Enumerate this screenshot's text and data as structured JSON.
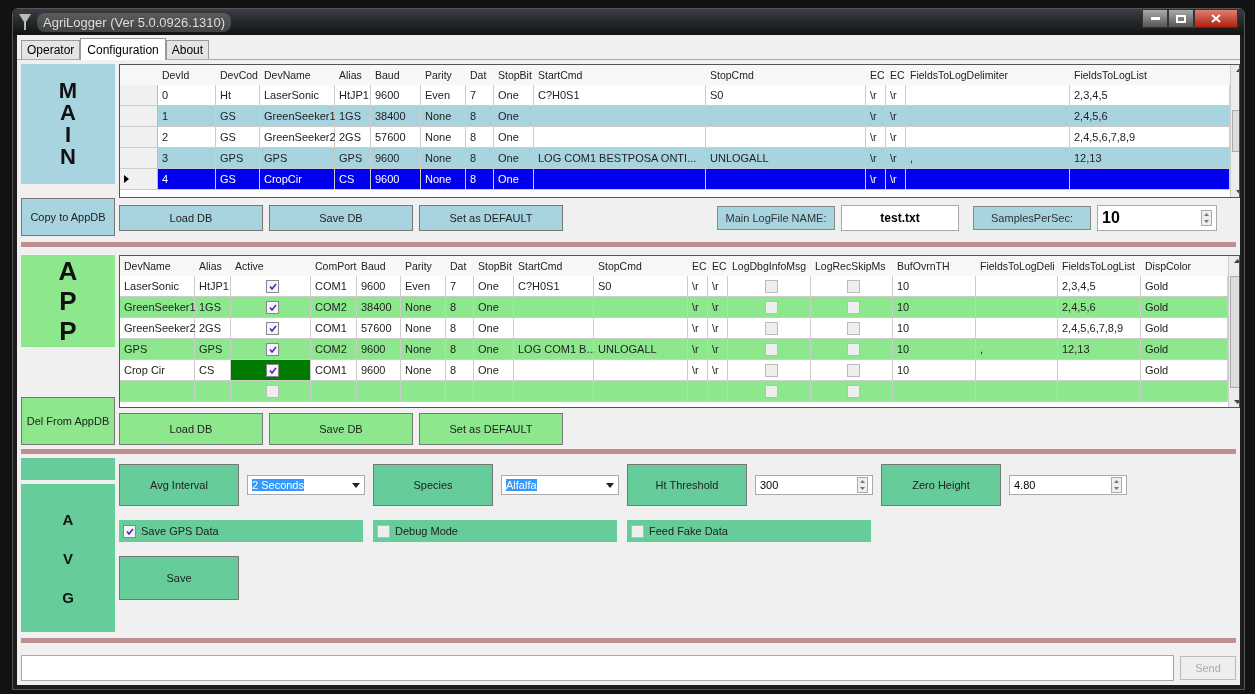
{
  "window": {
    "title": "AgriLogger (Ver 5.0.0926.1310)"
  },
  "tabs": [
    {
      "label": "Operator",
      "selected": false
    },
    {
      "label": "Configuration",
      "selected": true
    },
    {
      "label": "About",
      "selected": false
    }
  ],
  "main": {
    "label": [
      "M",
      "A",
      "I",
      "N"
    ],
    "side_button": "Copy to AppDB",
    "grid": {
      "columns": [
        "DevId",
        "DevCod",
        "DevName",
        "Alias",
        "Baud",
        "Parity",
        "Dat",
        "StopBit",
        "StartCmd",
        "StopCmd",
        "EC",
        "EC",
        "FieldsToLogDelimiter",
        "FieldsToLogList"
      ],
      "rows": [
        {
          "selected": false,
          "cells": [
            "0",
            "Ht",
            "LaserSonic",
            "HtJP1",
            "9600",
            "Even",
            "7",
            "One",
            "C?H0S1",
            "S0",
            "\\r",
            "\\r",
            null,
            "2,3,4,5"
          ]
        },
        {
          "selected": false,
          "cells": [
            "1",
            "GS",
            "GreenSeeker1",
            "1GS",
            "38400",
            "None",
            "8",
            "One",
            null,
            null,
            "\\r",
            "\\r",
            null,
            "2,4,5,6"
          ]
        },
        {
          "selected": false,
          "cells": [
            "2",
            "GS",
            "GreenSeeker2",
            "2GS",
            "57600",
            "None",
            "8",
            "One",
            null,
            null,
            "\\r",
            "\\r",
            null,
            "2,4,5,6,7,8,9"
          ]
        },
        {
          "selected": false,
          "cells": [
            "3",
            "GPS",
            "GPS",
            "GPS",
            "9600",
            "None",
            "8",
            "One",
            "LOG COM1 BESTPOSA ONTI...",
            "UNLOGALL",
            "\\r",
            "\\r",
            ",",
            "12,13"
          ]
        },
        {
          "selected": true,
          "cells": [
            "4",
            "GS",
            "CropCir",
            "CS",
            "9600",
            "None",
            "8",
            "One",
            null,
            null,
            "\\r",
            "\\r",
            null,
            null
          ]
        }
      ]
    },
    "buttons": [
      "Load DB",
      "Save DB",
      "Set as DEFAULT"
    ],
    "logfile_label": "Main LogFile NAME:",
    "logfile": "test.txt",
    "samples_label": "SamplesPerSec:",
    "samples": "10"
  },
  "app": {
    "label": [
      "A",
      "P",
      "P"
    ],
    "side_button": "Del From AppDB",
    "grid": {
      "columns": [
        {
          "label": "DevName",
          "kind": "text"
        },
        {
          "label": "Alias",
          "kind": "text"
        },
        {
          "label": "Active",
          "kind": "check"
        },
        {
          "label": "ComPort",
          "kind": "text"
        },
        {
          "label": "Baud",
          "kind": "text"
        },
        {
          "label": "Parity",
          "kind": "text"
        },
        {
          "label": "Dat",
          "kind": "text"
        },
        {
          "label": "StopBit",
          "kind": "text"
        },
        {
          "label": "StartCmd",
          "kind": "text"
        },
        {
          "label": "StopCmd",
          "kind": "text"
        },
        {
          "label": "EC",
          "kind": "text"
        },
        {
          "label": "EC",
          "kind": "text"
        },
        {
          "label": "LogDbgInfoMsg",
          "kind": "check"
        },
        {
          "label": "LogRecSkipMs",
          "kind": "check"
        },
        {
          "label": "BufOvrnTH",
          "kind": "text"
        },
        {
          "label": "FieldsToLogDeli",
          "kind": "text"
        },
        {
          "label": "FieldsToLogList",
          "kind": "text"
        },
        {
          "label": "DispColor",
          "kind": "text"
        }
      ],
      "rows": [
        {
          "cells": [
            "LaserSonic",
            "HtJP1",
            {
              "checked": true,
              "current": false
            },
            "COM1",
            "9600",
            "Even",
            "7",
            "One",
            "C?H0S1",
            "S0",
            "\\r",
            "\\r",
            {
              "checked": false,
              "current": false
            },
            {
              "checked": false,
              "current": false
            },
            "10",
            null,
            "2,3,4,5",
            "Gold"
          ]
        },
        {
          "cells": [
            "GreenSeeker1",
            "1GS",
            {
              "checked": true,
              "current": false
            },
            "COM2",
            "38400",
            "None",
            "8",
            "One",
            null,
            null,
            "\\r",
            "\\r",
            {
              "checked": false,
              "current": false
            },
            {
              "checked": false,
              "current": false
            },
            "10",
            null,
            "2,4,5,6",
            "Gold"
          ]
        },
        {
          "cells": [
            "GreenSeeker2",
            "2GS",
            {
              "checked": true,
              "current": false
            },
            "COM1",
            "57600",
            "None",
            "8",
            "One",
            null,
            null,
            "\\r",
            "\\r",
            {
              "checked": false,
              "current": false
            },
            {
              "checked": false,
              "current": false
            },
            "10",
            null,
            "2,4,5,6,7,8,9",
            "Gold"
          ]
        },
        {
          "cells": [
            "GPS",
            "GPS",
            {
              "checked": true,
              "current": false
            },
            "COM2",
            "9600",
            "None",
            "8",
            "One",
            "LOG COM1 B...",
            "UNLOGALL",
            "\\r",
            "\\r",
            {
              "checked": false,
              "current": false
            },
            {
              "checked": false,
              "current": false
            },
            "10",
            ",",
            "12,13",
            "Gold"
          ]
        },
        {
          "cells": [
            "Crop Cir",
            "CS",
            {
              "checked": true,
              "current": true
            },
            "COM1",
            "9600",
            "None",
            "8",
            "One",
            null,
            null,
            "\\r",
            "\\r",
            {
              "checked": false,
              "current": false
            },
            {
              "checked": false,
              "current": false
            },
            "10",
            null,
            null,
            "Gold"
          ]
        },
        {
          "cells": [
            null,
            null,
            {
              "checked": false,
              "current": false
            },
            null,
            null,
            null,
            null,
            null,
            null,
            null,
            null,
            null,
            {
              "checked": false,
              "current": false
            },
            {
              "checked": false,
              "current": false
            },
            null,
            null,
            null,
            null
          ]
        }
      ]
    },
    "buttons": [
      "Load DB",
      "Save DB",
      "Set as DEFAULT"
    ]
  },
  "avg": {
    "label": [
      "A",
      "V",
      "G"
    ],
    "settings": [
      {
        "button": "Avg Interval",
        "kind": "combo",
        "value": "2 Seconds"
      },
      {
        "button": "Species",
        "kind": "combo",
        "value": "Alfalfa"
      },
      {
        "button": "Ht Threshold",
        "kind": "spin",
        "value": "300"
      },
      {
        "button": "Zero Height",
        "kind": "spin",
        "value": "4.80"
      }
    ],
    "options": [
      {
        "label": "Save GPS Data",
        "checked": true
      },
      {
        "label": "Debug Mode",
        "checked": false
      },
      {
        "label": "Feed Fake Data",
        "checked": false
      }
    ],
    "save": "Save"
  },
  "footer": {
    "send": "Send"
  }
}
